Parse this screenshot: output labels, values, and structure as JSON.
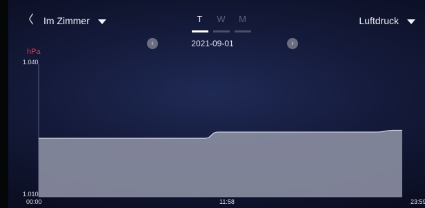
{
  "header": {
    "back_glyph": "〈",
    "room_label": "Im Zimmer",
    "measure_label": "Luftdruck",
    "tabs": [
      {
        "label": "T",
        "active": true
      },
      {
        "label": "W",
        "active": false
      },
      {
        "label": "M",
        "active": false
      }
    ]
  },
  "date_nav": {
    "date": "2021-09-01",
    "prev_glyph": "‹",
    "next_glyph": "›"
  },
  "colors": {
    "unit_label": "#e0344a",
    "area_fill": "#8c8fa2",
    "line": "#d8dae6"
  },
  "chart_data": {
    "type": "area",
    "unit": "hPa",
    "y_tick_labels": [
      "1.040",
      "1.010"
    ],
    "ylim": [
      1.01,
      1.04
    ],
    "x_tick_labels": [
      "00:00",
      "11:58",
      "23:59"
    ],
    "x_hours": [
      0,
      11.0,
      11.8,
      21.8,
      22.3,
      23.4,
      23.99
    ],
    "values": [
      1.0232,
      1.0232,
      1.0246,
      1.0246,
      1.0246,
      1.025,
      1.025
    ]
  }
}
